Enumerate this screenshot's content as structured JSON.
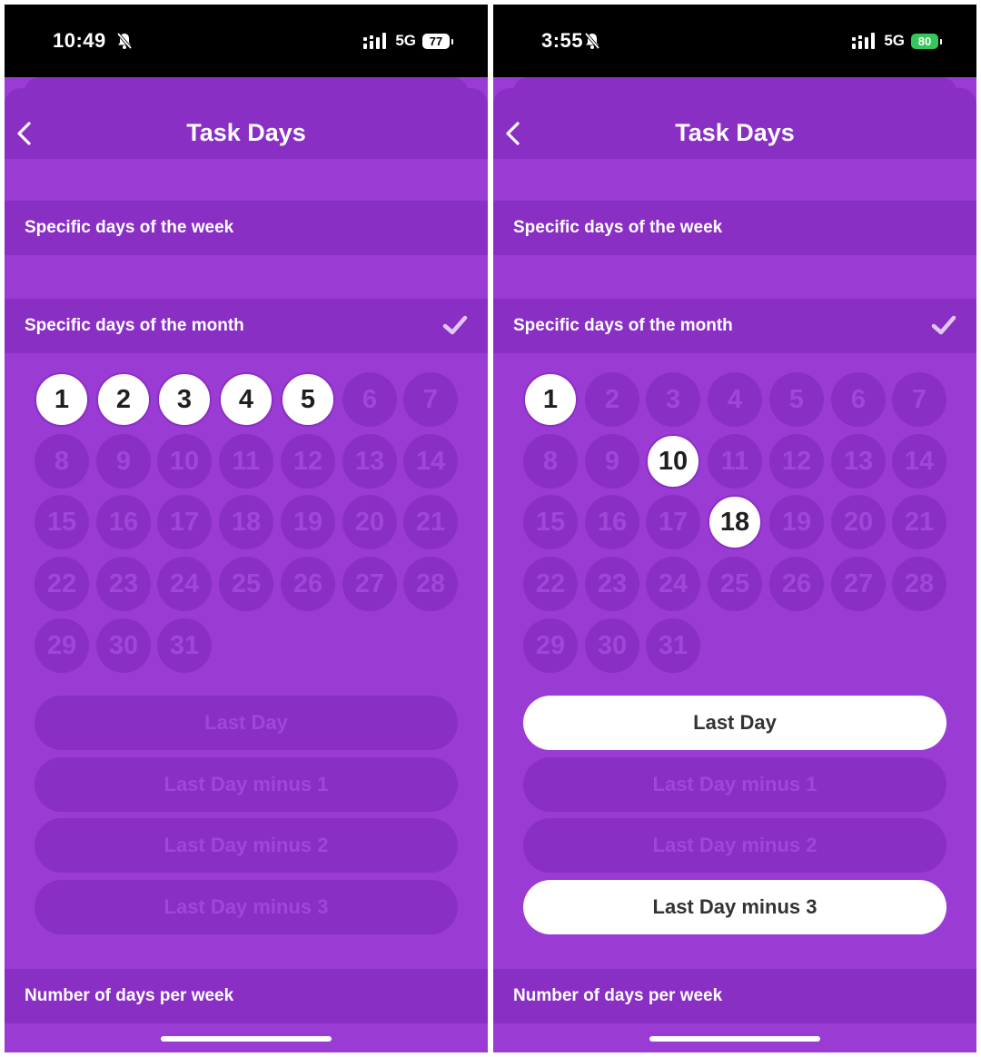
{
  "screens": [
    {
      "status": {
        "time": "10:49",
        "network": "5G",
        "battery": "77",
        "battery_color": "#ffffff",
        "battery_text_color": "#000000"
      },
      "header": {
        "title": "Task Days"
      },
      "sections": {
        "week": "Specific days of the week",
        "month": "Specific days of the month",
        "per_week": "Number of days per week"
      },
      "month_checked": true,
      "days": [
        "1",
        "2",
        "3",
        "4",
        "5",
        "6",
        "7",
        "8",
        "9",
        "10",
        "11",
        "12",
        "13",
        "14",
        "15",
        "16",
        "17",
        "18",
        "19",
        "20",
        "21",
        "22",
        "23",
        "24",
        "25",
        "26",
        "27",
        "28",
        "29",
        "30",
        "31"
      ],
      "selected_days": [
        1,
        2,
        3,
        4,
        5
      ],
      "options": [
        "Last Day",
        "Last Day minus 1",
        "Last Day minus 2",
        "Last Day minus 3"
      ],
      "selected_options": []
    },
    {
      "status": {
        "time": "3:55",
        "network": "5G",
        "battery": "80",
        "battery_color": "#34c759",
        "battery_text_color": "#ffffff"
      },
      "header": {
        "title": "Task Days"
      },
      "sections": {
        "week": "Specific days of the week",
        "month": "Specific days of the month",
        "per_week": "Number of days per week"
      },
      "month_checked": true,
      "days": [
        "1",
        "2",
        "3",
        "4",
        "5",
        "6",
        "7",
        "8",
        "9",
        "10",
        "11",
        "12",
        "13",
        "14",
        "15",
        "16",
        "17",
        "18",
        "19",
        "20",
        "21",
        "22",
        "23",
        "24",
        "25",
        "26",
        "27",
        "28",
        "29",
        "30",
        "31"
      ],
      "selected_days": [
        1,
        10,
        18
      ],
      "options": [
        "Last Day",
        "Last Day minus 1",
        "Last Day minus 2",
        "Last Day minus 3"
      ],
      "selected_options": [
        0,
        3
      ]
    }
  ],
  "colors": {
    "accent": "#9a3bd4",
    "row": "#8a2fc4",
    "muted_text": "#9f47d6",
    "selected": "#ffffff"
  },
  "icons": {
    "back": "chevron-left-icon",
    "check": "checkmark-icon",
    "bell": "bell-slash-icon",
    "signal": "signal-icon",
    "battery": "battery-icon"
  }
}
